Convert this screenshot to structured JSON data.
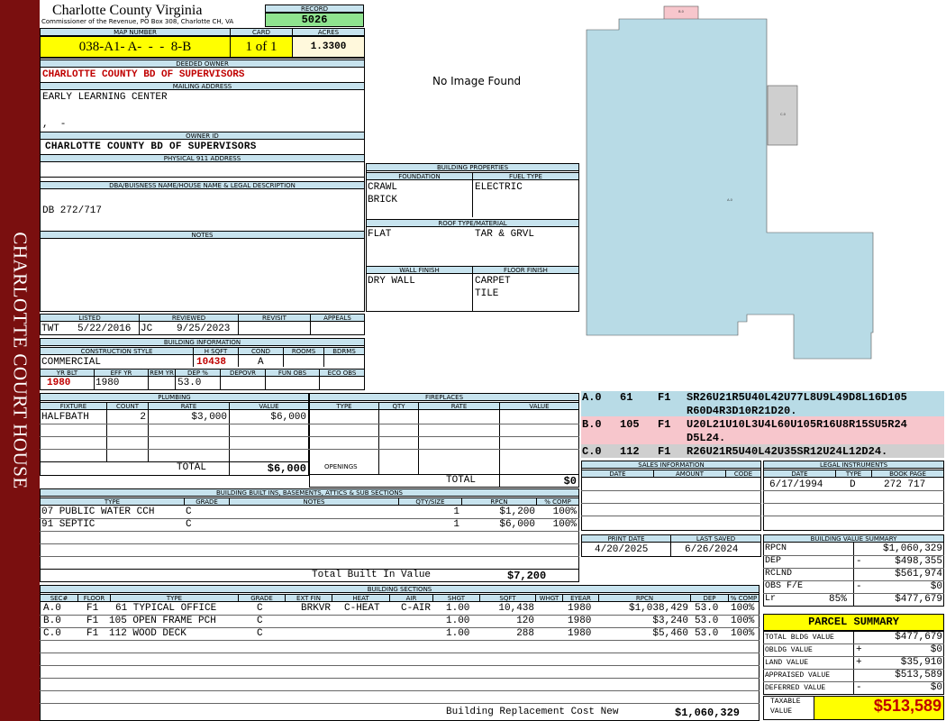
{
  "sidebar": {
    "title": "CHARLOTTE COURT HOUSE"
  },
  "header": {
    "county": "Charlotte County Virginia",
    "commissioner": "Commissioner of the Revenue, PO Box 308, Charlotte CH, VA",
    "record_label": "RECORD",
    "record": "5026"
  },
  "map": {
    "map_label": "MAP NUMBER",
    "map_number": "038-A1- A-  -  -  8-B",
    "card_label": "CARD",
    "card": "1 of 1",
    "acres_label": "ACRES",
    "acres": "1.3300"
  },
  "owner": {
    "deeded_label": "DEEDED OWNER",
    "deeded": "CHARLOTTE COUNTY BD OF SUPERVISORS",
    "mailing_label": "MAILING ADDRESS",
    "mailing1": "EARLY LEARNING CENTER",
    "mailing3": ",  -",
    "owner_id_label": "OWNER ID",
    "owner_id": "CHARLOTTE COUNTY BD OF SUPERVISORS",
    "physical_label": "PHYSICAL 911 ADDRESS",
    "dba_label": "DBA/BUISNESS NAME/HOUSE NAME & LEGAL DESCRIPTION",
    "dba": "DB 272/717",
    "notes_label": "NOTES"
  },
  "image": {
    "no_image": "No Image Found"
  },
  "listing": {
    "listed_label": "LISTED",
    "reviewed_label": "REVIEWED",
    "revisit_label": "REVISIT",
    "appeals_label": "APPEALS",
    "listed_by": "TWT",
    "listed_date": "5/22/2016",
    "reviewed_by": "JC",
    "reviewed_date": "9/25/2023"
  },
  "building_info": {
    "title": "BUILDING INFORMATION",
    "construction_label": "CONSTRUCTION STYLE",
    "hsqft_label": "H SQFT",
    "cond_label": "COND",
    "rooms_label": "ROOMS",
    "bdrms_label": "BDRMS",
    "construction": "COMMERCIAL",
    "hsqft": "10438",
    "cond": "A",
    "yrblt_label": "YR BLT",
    "effyr_label": "EFF YR",
    "remyr_label": "REM YR",
    "dep_label": "DEP %",
    "depovr_label": "DEPOVR",
    "funobs_label": "FUN OBS",
    "ecoobs_label": "ECO OBS",
    "yrblt": "1980",
    "effyr": "1980",
    "dep": "53.0"
  },
  "building_props": {
    "title": "BUILDING PROPERTIES",
    "foundation_label": "FOUNDATION",
    "fuel_label": "FUEL TYPE",
    "foundation1": "CRAWL",
    "foundation2": "BRICK",
    "fuel": "ELECTRIC",
    "roof_label": "ROOF TYPE/MATERIAL",
    "roof1": "FLAT",
    "roof2": "TAR & GRVL",
    "wall_label": "WALL FINISH",
    "floor_label": "FLOOR FINISH",
    "wall": "DRY WALL",
    "floor1": "CARPET",
    "floor2": "TILE"
  },
  "plumbing": {
    "title": "PLUMBING",
    "fixture_label": "FIXTURE",
    "count_label": "COUNT",
    "rate_label": "RATE",
    "value_label": "VALUE",
    "rows": [
      {
        "fixture": "HALFBATH",
        "count": "2",
        "rate": "$3,000",
        "value": "$6,000"
      }
    ],
    "total_label": "TOTAL",
    "total": "$6,000"
  },
  "fireplaces": {
    "title": "FIREPLACES",
    "type_label": "TYPE",
    "qty_label": "QTY",
    "rate_label": "RATE",
    "value_label": "VALUE",
    "openings_label": "OPENINGS",
    "total_label": "TOTAL",
    "total": "$0"
  },
  "sketch": {
    "labels": {
      "top": "B.0",
      "side": "C.0",
      "main": "A.0"
    },
    "sections": [
      {
        "id": "A.0",
        "count": "61",
        "floor": "F1",
        "text1": "SR26U21R5U40L42U77L8U9L49D8L16D105",
        "text2": "R60D4R3D10R21D20."
      },
      {
        "id": "B.0",
        "count": "105",
        "floor": "F1",
        "text1": "U20L21U10L3U4L60U105R16U8R15SU5R24",
        "text2": "D5L24."
      },
      {
        "id": "C.0",
        "count": "112",
        "floor": "F1",
        "text1": "R26U21R5U40L42U35SR12U24L12D24.",
        "text2": ""
      }
    ],
    "colors": {
      "a": "#b8dbe6",
      "b": "#f7c6cc",
      "c": "#cfcfcf"
    }
  },
  "built_ins": {
    "title": "BUILDING BUILT INS, BASEMENTS, ATTICS & SUB SECTIONS",
    "type_label": "TYPE",
    "grade_label": "GRADE",
    "notes_label": "NOTES",
    "qty_label": "QTY/SIZE",
    "rpcn_label": "RPCN",
    "comp_label": "% COMP",
    "rows": [
      {
        "type": "07 PUBLIC WATER CCH",
        "grade": "C",
        "qty": "1",
        "rpcn": "$1,200",
        "comp": "100%"
      },
      {
        "type": "91 SEPTIC",
        "grade": "C",
        "qty": "1",
        "rpcn": "$6,000",
        "comp": "100%"
      }
    ],
    "total_label": "Total Built In Value",
    "total": "$7,200"
  },
  "sales": {
    "title": "SALES INFORMATION",
    "date_label": "DATE",
    "amount_label": "AMOUNT",
    "code_label": "CODE"
  },
  "legal": {
    "title": "LEGAL INSTRUMENTS",
    "date_label": "DATE",
    "type_label": "TYPE",
    "book_label": "BOOK PAGE",
    "date": "6/17/1994",
    "type": "D",
    "book": "272 717"
  },
  "print": {
    "print_label": "PRINT DATE",
    "saved_label": "LAST SAVED",
    "print_date": "4/20/2025",
    "saved_date": "6/26/2024"
  },
  "value_summary": {
    "title": "BUILDING VALUE SUMMARY",
    "rows": [
      {
        "label": "RPCN",
        "sign": "",
        "value": "$1,060,329"
      },
      {
        "label": "DEP",
        "sign": "-",
        "value": "$498,355"
      },
      {
        "label": "RCLND",
        "sign": "",
        "value": "$561,974"
      },
      {
        "label": "OBS F/E",
        "sign": "-",
        "value": "$0"
      },
      {
        "label": "Lr",
        "pct": "85%",
        "sign": "",
        "value": "$477,679"
      }
    ]
  },
  "parcel": {
    "title": "PARCEL SUMMARY",
    "rows": [
      {
        "label": "TOTAL BLDG VALUE",
        "sign": "",
        "value": "$477,679"
      },
      {
        "label": "OBLDG VALUE",
        "sign": "+",
        "value": "$0"
      },
      {
        "label": "LAND VALUE",
        "sign": "+",
        "value": "$35,910"
      },
      {
        "label": "APPRAISED VALUE",
        "sign": "",
        "value": "$513,589"
      },
      {
        "label": "DEFERRED VALUE",
        "sign": "-",
        "value": "$0"
      }
    ],
    "taxable_label1": "TAXABLE",
    "taxable_label2": "VALUE",
    "taxable": "$513,589"
  },
  "sections": {
    "title": "BUILDING SECTIONS",
    "headers": {
      "sec": "SEC#",
      "floor": "FLOOR",
      "type": "TYPE",
      "grade": "GRADE",
      "extfin": "EXT FIN",
      "heat": "HEAT",
      "air": "AIR",
      "shgt": "SHGT",
      "sqft": "SQFT",
      "whgt": "WHGT",
      "eyear": "EYEAR",
      "rpcn": "RPCN",
      "dep": "DEP",
      "comp": "% COMP"
    },
    "rows": [
      {
        "sec": "A.0",
        "floor": "F1",
        "type": "61 TYPICAL OFFICE",
        "grade": "C",
        "extfin": "BRKVR",
        "heat": "C-HEAT",
        "air": "C-AIR",
        "shgt": "1.00",
        "sqft": "10,438",
        "eyear": "1980",
        "rpcn": "$1,038,429",
        "dep": "53.0",
        "comp": "100%"
      },
      {
        "sec": "B.0",
        "floor": "F1",
        "type": "105 OPEN FRAME PCH",
        "grade": "C",
        "extfin": "",
        "heat": "",
        "air": "",
        "shgt": "1.00",
        "sqft": "120",
        "eyear": "1980",
        "rpcn": "$3,240",
        "dep": "53.0",
        "comp": "100%"
      },
      {
        "sec": "C.0",
        "floor": "F1",
        "type": "112 WOOD DECK",
        "grade": "C",
        "extfin": "",
        "heat": "",
        "air": "",
        "shgt": "1.00",
        "sqft": "288",
        "eyear": "1980",
        "rpcn": "$5,460",
        "dep": "53.0",
        "comp": "100%"
      }
    ],
    "total_label": "Building Replacement Cost New",
    "total": "$1,060,329"
  }
}
